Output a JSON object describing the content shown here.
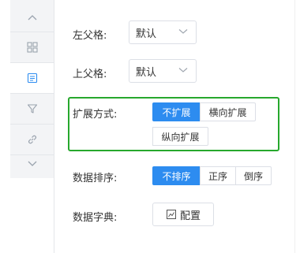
{
  "sidebar": {
    "items": [
      {
        "icon": "chevron-up-icon"
      },
      {
        "icon": "grid-icon"
      },
      {
        "icon": "list-icon",
        "active": true
      },
      {
        "icon": "filter-icon"
      },
      {
        "icon": "link-icon"
      },
      {
        "icon": "chevron-down-icon"
      }
    ]
  },
  "form": {
    "left_parent": {
      "label": "左父格:",
      "value": "默认"
    },
    "top_parent": {
      "label": "上父格:",
      "value": "默认"
    },
    "expand_mode": {
      "label": "扩展方式:",
      "options": [
        "不扩展",
        "横向扩展",
        "纵向扩展"
      ],
      "selected": "不扩展"
    },
    "sort": {
      "label": "数据排序:",
      "options": [
        "不排序",
        "正序",
        "倒序"
      ],
      "selected": "不排序"
    },
    "dictionary": {
      "label": "数据字典:",
      "button": "配置"
    }
  },
  "colors": {
    "accent": "#2d8cf0",
    "highlight": "#27a82d"
  }
}
